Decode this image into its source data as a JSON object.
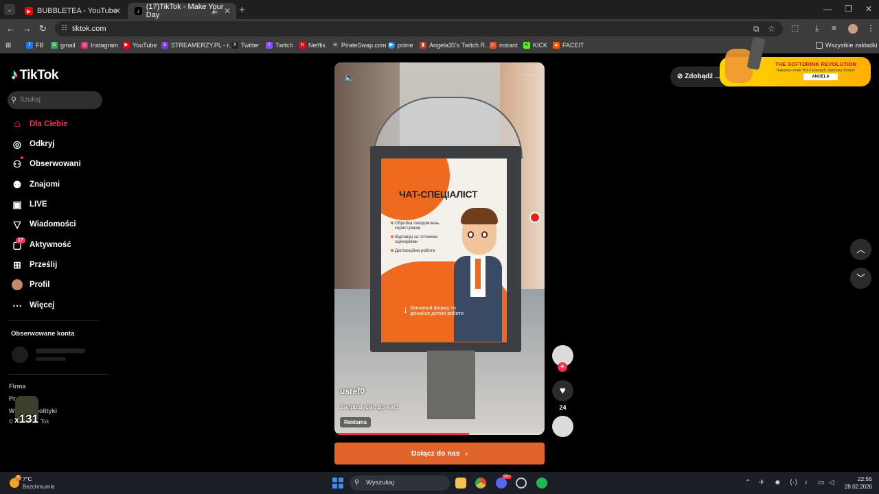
{
  "browser": {
    "tabs": [
      {
        "title": "BUBBLETEA - YouTube",
        "active": false
      },
      {
        "title": "(17)TikTok - Make Your Day",
        "active": true
      }
    ],
    "url": "tiktok.com",
    "bookmarks": [
      {
        "label": "FB",
        "icon": "facebook-icon",
        "color": "#1877f2"
      },
      {
        "label": "gmail",
        "icon": "google-icon",
        "color": "#34a853"
      },
      {
        "label": "Instagram",
        "icon": "instagram-icon",
        "color": "#d62976"
      },
      {
        "label": "YouTube",
        "icon": "youtube-icon",
        "color": "#ff0000"
      },
      {
        "label": "STREAMERZY.PL - r...",
        "icon": "streamerzy-icon",
        "color": "#7a3cc9"
      },
      {
        "label": "Twitter",
        "icon": "x-icon",
        "color": "#222222"
      },
      {
        "label": "Twitch",
        "icon": "twitch-icon",
        "color": "#9146ff"
      },
      {
        "label": "Netflix",
        "icon": "netflix-icon",
        "color": "#e50914"
      },
      {
        "label": "PirateSwap.com",
        "icon": "pirateswap-icon",
        "color": "#444444"
      },
      {
        "label": "prime",
        "icon": "prime-icon",
        "color": "#1a98ff"
      },
      {
        "label": "Angela35's Twitch R...",
        "icon": "chart-icon",
        "color": "#c0392b"
      },
      {
        "label": "instant",
        "icon": "instant-icon",
        "color": "#e44d26"
      },
      {
        "label": "KICK",
        "icon": "kick-icon",
        "color": "#53fc18"
      },
      {
        "label": "FACEIT",
        "icon": "faceit-icon",
        "color": "#ff5500"
      }
    ],
    "all_bookmarks_label": "Wszystkie zakładki"
  },
  "tiktok": {
    "logo_text": "TikTok",
    "search_placeholder": "Szukaj",
    "nav": [
      {
        "label": "Dla Ciebie",
        "icon": "home-icon",
        "glyph": "⌂"
      },
      {
        "label": "Odkryj",
        "icon": "compass-icon",
        "glyph": "◎"
      },
      {
        "label": "Obserwowani",
        "icon": "user-plus-icon",
        "glyph": "⚇"
      },
      {
        "label": "Znajomi",
        "icon": "friends-icon",
        "glyph": "⚉"
      },
      {
        "label": "LIVE",
        "icon": "live-tv-icon",
        "glyph": "▣"
      },
      {
        "label": "Wiadomości",
        "icon": "send-icon",
        "glyph": "▽"
      },
      {
        "label": "Aktywność",
        "icon": "activity-icon",
        "glyph": "▢"
      },
      {
        "label": "Prześlij",
        "icon": "upload-icon",
        "glyph": "⊞"
      },
      {
        "label": "Profil",
        "icon": "profile-avatar-icon",
        "glyph": "●"
      },
      {
        "label": "Więcej",
        "icon": "more-icon",
        "glyph": "⋯"
      }
    ],
    "activity_badge": "17",
    "followed_accounts_title": "Obserwowane konta",
    "footer_firma": "Firma",
    "footer_line2": "Pr",
    "footer_line3_a": "W",
    "footer_line3_b": "polityki",
    "footer_line4_a": "©",
    "footer_line4_b": "Tok",
    "overlay_number": "131",
    "coins_button": "Zdobądź ...",
    "video": {
      "poster_title": "ЧАТ-СПЕЦІАЛІСТ",
      "poster_bullets": [
        "Обробка повідомлень користувачів",
        "Відповіді за готовими сценаріями",
        "Дистанційна робота"
      ],
      "poster_cta": "Заповной форму та дізнайся деталі роботи",
      "username": "usref0",
      "caption": "Запрошуємо до нас!",
      "ad_label": "Reklama",
      "progress": 0.64
    },
    "cta_button": "Dołącz do nas",
    "like_count": "24"
  },
  "banner_ad": {
    "title": "THE SOFTDRINK REVOLUTION",
    "subtitle": "Najlepsze smaki HOLY Energy® i darmowy Shaker!",
    "name": "ANGELA"
  },
  "taskbar": {
    "temperature": "7°C",
    "weather": "Bezchmurnie",
    "weather_badge": "3",
    "search_label": "Wyszukaj",
    "time": "22:55",
    "date": "28.02.2026",
    "discord_badge": "99+"
  }
}
